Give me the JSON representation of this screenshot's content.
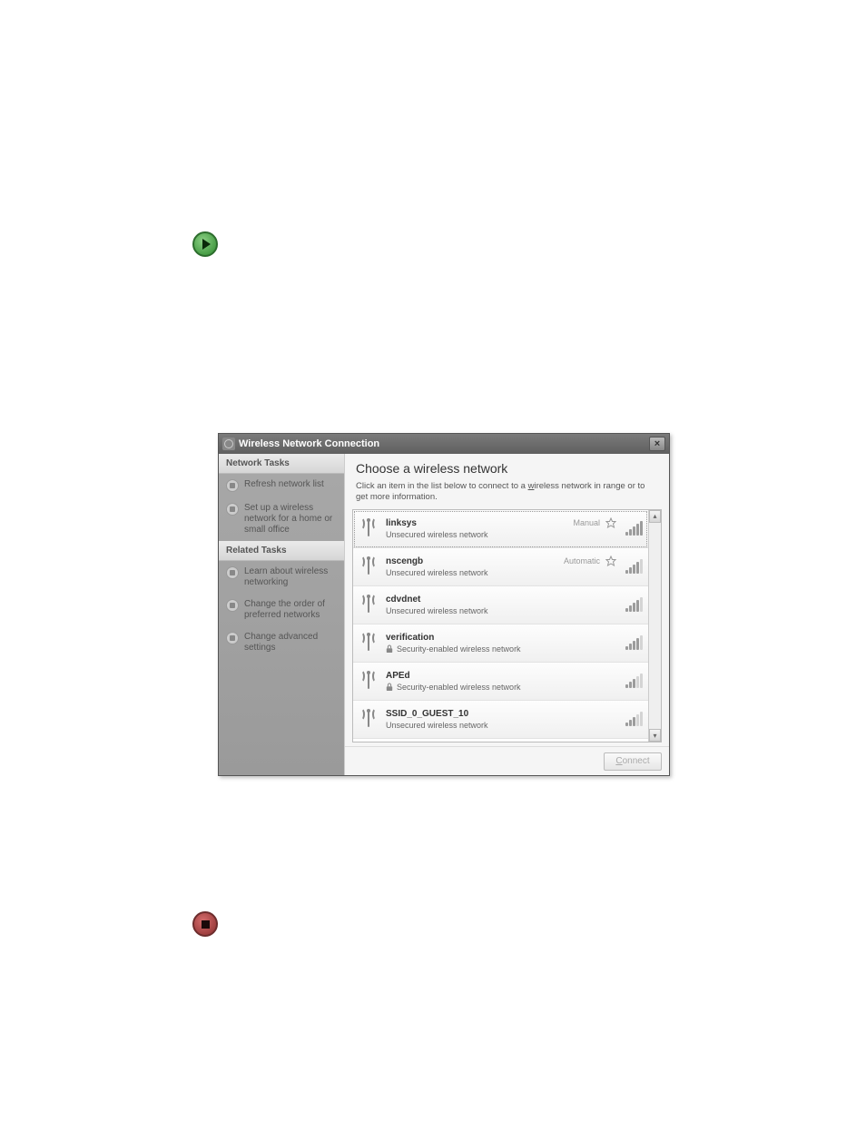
{
  "bullets": {
    "play": "play",
    "stop": "stop"
  },
  "window": {
    "title": "Wireless Network Connection",
    "close": "×"
  },
  "sidebar": {
    "headers": {
      "tasks": "Network Tasks",
      "related": "Related Tasks"
    },
    "tasks": [
      {
        "label": "Refresh network list"
      },
      {
        "label": "Set up a wireless network for a home or small office"
      }
    ],
    "related": [
      {
        "label": "Learn about wireless networking"
      },
      {
        "label": "Change the order of preferred networks"
      },
      {
        "label": "Change advanced settings"
      }
    ]
  },
  "main": {
    "heading": "Choose a wireless network",
    "sub_pre": "Click an item in the list below to connect to a ",
    "sub_ul": "w",
    "sub_post": "ireless network in range or to get more information.",
    "connect": "Connect",
    "modes": {
      "manual": "Manual",
      "automatic": "Automatic"
    },
    "sec_labels": {
      "unsecured": "Unsecured wireless network",
      "secured": "Security-enabled wireless network"
    }
  },
  "networks": [
    {
      "ssid": "linksys",
      "secured": false,
      "mode": "manual",
      "starred": true,
      "signal": 5,
      "selected": true
    },
    {
      "ssid": "nscengb",
      "secured": false,
      "mode": "automatic",
      "starred": true,
      "signal": 4,
      "selected": false
    },
    {
      "ssid": "cdvdnet",
      "secured": false,
      "mode": null,
      "starred": false,
      "signal": 4,
      "selected": false
    },
    {
      "ssid": "verification",
      "secured": true,
      "mode": null,
      "starred": false,
      "signal": 4,
      "selected": false
    },
    {
      "ssid": "APEd",
      "secured": true,
      "mode": null,
      "starred": false,
      "signal": 3,
      "selected": false
    },
    {
      "ssid": "SSID_0_GUEST_10",
      "secured": false,
      "mode": null,
      "starred": false,
      "signal": 3,
      "selected": false
    }
  ]
}
